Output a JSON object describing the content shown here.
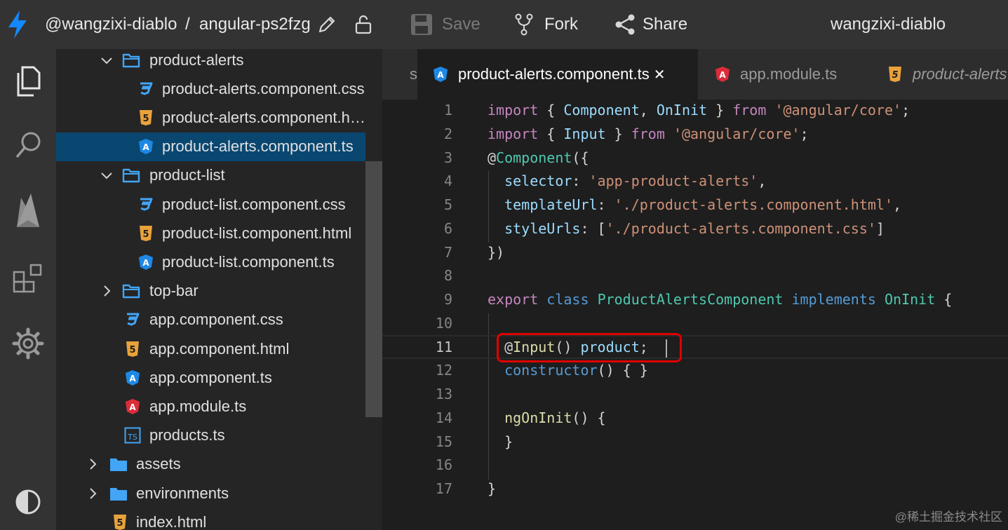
{
  "topbar": {
    "user": "@wangzixi-diablo",
    "separator": "/",
    "project": "angular-ps2fzg",
    "save_label": "Save",
    "fork_label": "Fork",
    "share_label": "Share",
    "account_name": "wangzixi-diablo",
    "icons": [
      "bolt-logo-icon",
      "pencil-icon",
      "unlock-icon",
      "save-disk-icon",
      "fork-icon",
      "share-icon"
    ]
  },
  "activity": {
    "items": [
      "files-icon",
      "search-icon",
      "firebase-icon",
      "extensions-icon",
      "settings-gear-icon",
      "theme-contrast-icon"
    ]
  },
  "sidebar": {
    "rows": [
      {
        "label": "product-alerts",
        "kind": "folder-open"
      },
      {
        "label": "product-alerts.component.css",
        "kind": "css"
      },
      {
        "label": "product-alerts.component.html",
        "kind": "html"
      },
      {
        "label": "product-alerts.component.ts",
        "kind": "angular-blue",
        "selected": true
      },
      {
        "label": "product-list",
        "kind": "folder-open"
      },
      {
        "label": "product-list.component.css",
        "kind": "css"
      },
      {
        "label": "product-list.component.html",
        "kind": "html"
      },
      {
        "label": "product-list.component.ts",
        "kind": "angular-blue"
      },
      {
        "label": "top-bar",
        "kind": "folder-closed"
      },
      {
        "label": "app.component.css",
        "kind": "css"
      },
      {
        "label": "app.component.html",
        "kind": "html"
      },
      {
        "label": "app.component.ts",
        "kind": "angular-blue"
      },
      {
        "label": "app.module.ts",
        "kind": "angular-red"
      },
      {
        "label": "products.ts",
        "kind": "typescript"
      },
      {
        "label": "assets",
        "kind": "folder-closed-solid"
      },
      {
        "label": "environments",
        "kind": "folder-closed-solid"
      },
      {
        "label": "index.html",
        "kind": "html"
      }
    ]
  },
  "tabs": [
    {
      "label": "s",
      "kind": "none"
    },
    {
      "label": "product-alerts.component.ts",
      "kind": "angular-blue",
      "active": true,
      "close": "✕"
    },
    {
      "label": "app.module.ts",
      "kind": "angular-red"
    },
    {
      "label": "product-alerts",
      "kind": "html",
      "italic": true
    }
  ],
  "editor": {
    "lines": [
      {
        "n": "1",
        "tokens": [
          [
            "k",
            "import"
          ],
          [
            "p",
            " { "
          ],
          [
            "v",
            "Component"
          ],
          [
            "p",
            ", "
          ],
          [
            "v",
            "OnInit"
          ],
          [
            "p",
            " } "
          ],
          [
            "k",
            "from"
          ],
          [
            "p",
            " "
          ],
          [
            "s",
            "'@angular/core'"
          ],
          [
            "p",
            ";"
          ]
        ]
      },
      {
        "n": "2",
        "tokens": [
          [
            "k",
            "import"
          ],
          [
            "p",
            " { "
          ],
          [
            "v",
            "Input"
          ],
          [
            "p",
            " } "
          ],
          [
            "k",
            "from"
          ],
          [
            "p",
            " "
          ],
          [
            "s",
            "'@angular/core'"
          ],
          [
            "p",
            ";"
          ]
        ]
      },
      {
        "n": "3",
        "tokens": [
          [
            "p",
            "@"
          ],
          [
            "t",
            "Component"
          ],
          [
            "p",
            "({"
          ]
        ]
      },
      {
        "n": "4",
        "tokens": [
          [
            "p",
            "  "
          ],
          [
            "v",
            "selector"
          ],
          [
            "p",
            ": "
          ],
          [
            "s",
            "'app-product-alerts'"
          ],
          [
            "p",
            ","
          ]
        ]
      },
      {
        "n": "5",
        "tokens": [
          [
            "p",
            "  "
          ],
          [
            "v",
            "templateUrl"
          ],
          [
            "p",
            ": "
          ],
          [
            "s",
            "'./product-alerts.component.html'"
          ],
          [
            "p",
            ","
          ]
        ]
      },
      {
        "n": "6",
        "tokens": [
          [
            "p",
            "  "
          ],
          [
            "v",
            "styleUrls"
          ],
          [
            "p",
            ": ["
          ],
          [
            "s",
            "'./product-alerts.component.css'"
          ],
          [
            "p",
            "]"
          ]
        ]
      },
      {
        "n": "7",
        "tokens": [
          [
            "p",
            "})"
          ]
        ]
      },
      {
        "n": "8",
        "tokens": []
      },
      {
        "n": "9",
        "tokens": [
          [
            "k",
            "export"
          ],
          [
            "p",
            " "
          ],
          [
            "kb",
            "class"
          ],
          [
            "p",
            " "
          ],
          [
            "t",
            "ProductAlertsComponent"
          ],
          [
            "p",
            " "
          ],
          [
            "kb",
            "implements"
          ],
          [
            "p",
            " "
          ],
          [
            "t",
            "OnInit"
          ],
          [
            "p",
            " {"
          ]
        ]
      },
      {
        "n": "10",
        "tokens": []
      },
      {
        "n": "11",
        "tokens": [
          [
            "p",
            "  @"
          ],
          [
            "f",
            "Input"
          ],
          [
            "p",
            "() "
          ],
          [
            "v",
            "product"
          ],
          [
            "p",
            ";"
          ]
        ],
        "current": true
      },
      {
        "n": "12",
        "tokens": [
          [
            "p",
            "  "
          ],
          [
            "kb",
            "constructor"
          ],
          [
            "p",
            "() { }"
          ]
        ]
      },
      {
        "n": "13",
        "tokens": []
      },
      {
        "n": "14",
        "tokens": [
          [
            "p",
            "  "
          ],
          [
            "f",
            "ngOnInit"
          ],
          [
            "p",
            "() {"
          ]
        ]
      },
      {
        "n": "15",
        "tokens": [
          [
            "p",
            "  }"
          ]
        ]
      },
      {
        "n": "16",
        "tokens": []
      },
      {
        "n": "17",
        "tokens": [
          [
            "p",
            "}"
          ]
        ]
      }
    ]
  },
  "colors": {
    "selection": "#094771",
    "highlight_box": "#e00000",
    "angular_blue": "#1e88e5",
    "angular_red": "#dd2c3a",
    "html_orange": "#e9a23b",
    "css_blue": "#42a5f5",
    "folder_blue": "#42a5f5"
  },
  "watermark": "@稀土掘金技术社区"
}
